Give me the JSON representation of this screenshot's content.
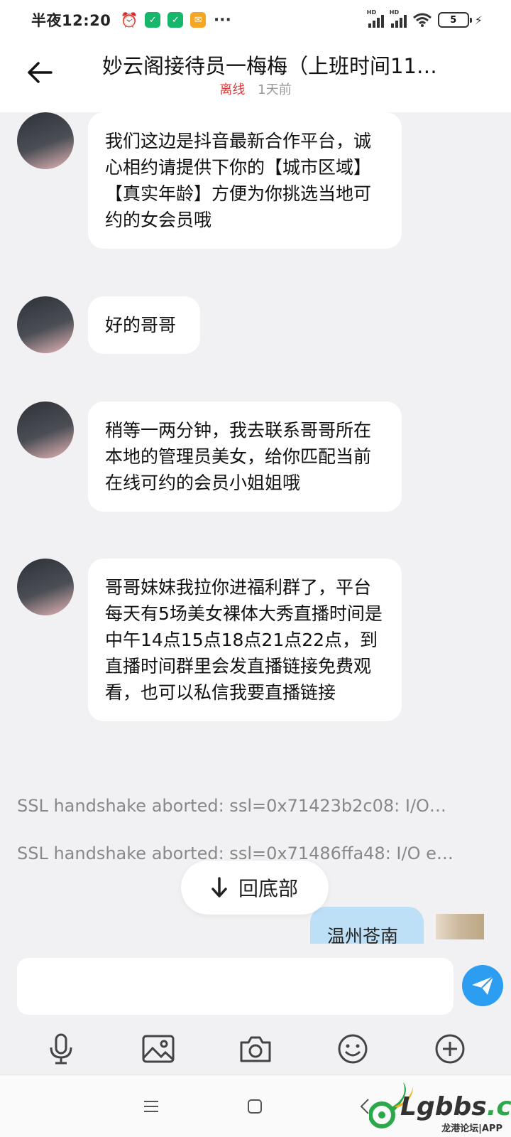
{
  "status_bar": {
    "time": "半夜12:20",
    "battery": "5",
    "signal_label": "HD"
  },
  "header": {
    "title": "妙云阁接待员一梅梅（上班时间11…",
    "status": "离线",
    "last_seen": "1天前"
  },
  "messages": [
    {
      "text": "我们这边是抖音最新合作平台，诚心相约请提供下你的【城市区域】【真实年龄】方便为你挑选当地可约的女会员哦"
    },
    {
      "text": "好的哥哥"
    },
    {
      "text": "稍等一两分钟，我去联系哥哥所在本地的管理员美女，给你匹配当前在线可约的会员小姐姐哦"
    },
    {
      "text": "哥哥妹妹我拉你进福利群了，平台每天有5场美女裸体大秀直播时间是中午14点15点18点21点22点，到直播时间群里会发直播链接免费观看，也可以私信我要直播链接"
    }
  ],
  "system_messages": [
    "SSL handshake aborted: ssl=0x71423b2c08: I/O…",
    "SSL handshake aborted: ssl=0x71486ffa48: I/O e…"
  ],
  "my_message": "温州苍南",
  "scroll_bottom_label": "回底部",
  "input": {
    "value": "",
    "placeholder": ""
  },
  "toolbar": [
    "microphone-icon",
    "image-icon",
    "camera-icon",
    "emoji-icon",
    "plus-icon"
  ],
  "watermark": {
    "brand": "Lgbbs",
    "tld": ".cn",
    "sub": "龙港论坛|APP"
  },
  "colors": {
    "accent": "#2c9df0",
    "offline": "#e03b3b",
    "my_bubble": "#bde0f7"
  }
}
